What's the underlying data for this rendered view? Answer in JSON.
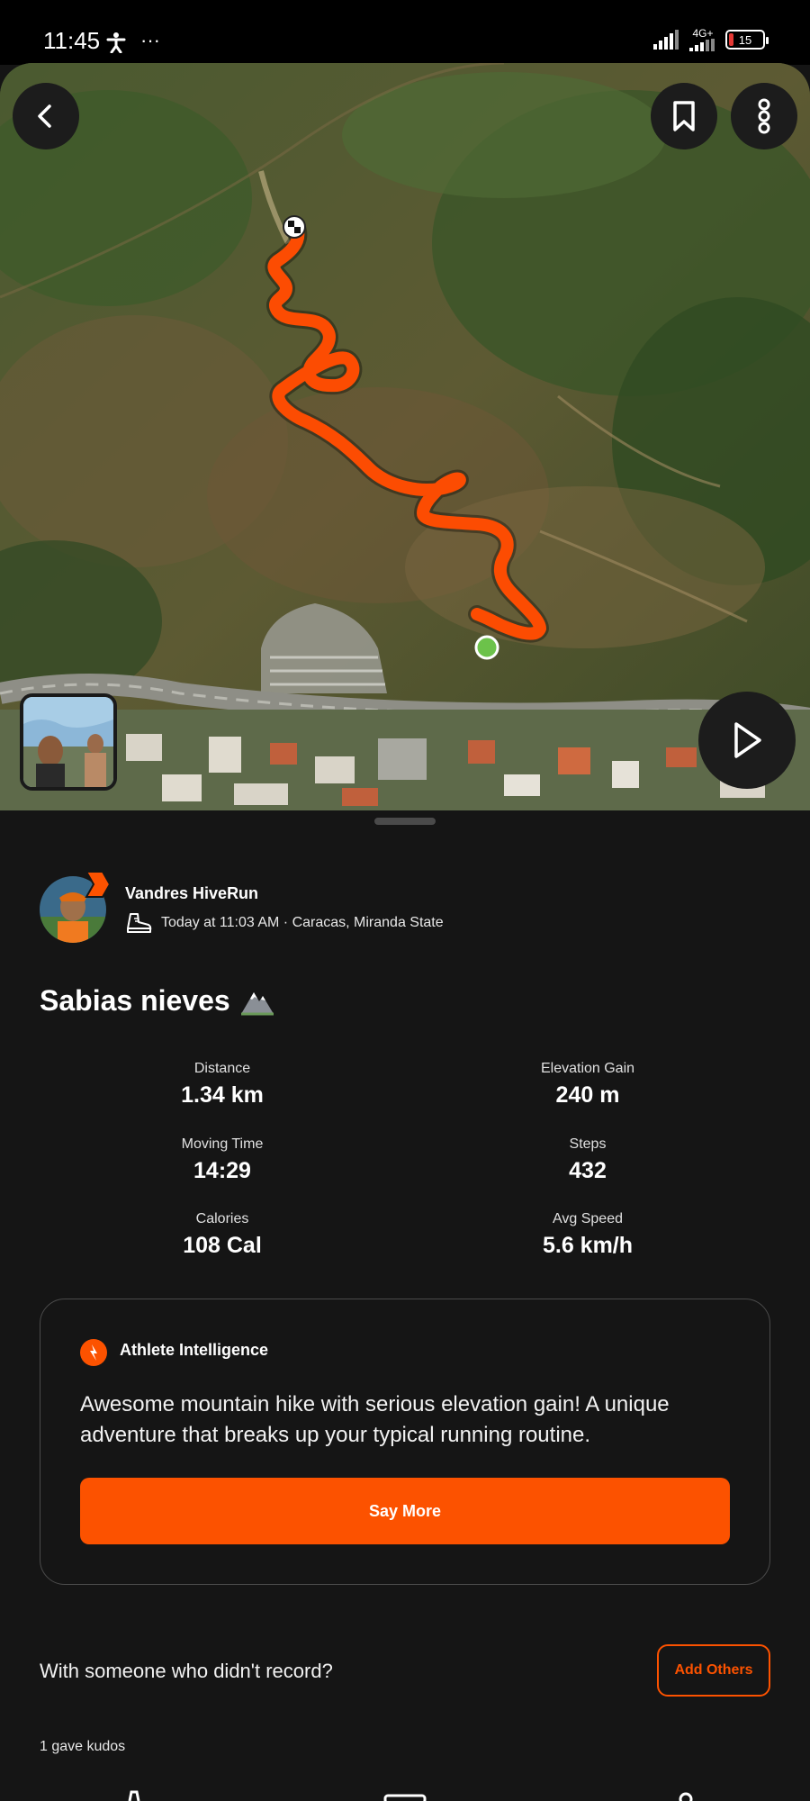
{
  "status_bar": {
    "time": "11:45",
    "left_icons": [
      "accessibility-icon",
      "more-dots-icon"
    ],
    "network": "4G+",
    "battery": "15"
  },
  "map": {
    "top_buttons": [
      "back-icon",
      "bookmark-icon",
      "more-vertical-icon"
    ],
    "play_icon": "play-icon",
    "route_color": "#fc4c02",
    "start_marker_color": "#6cc24a"
  },
  "activity": {
    "athlete_name": "Vandres HiveRun",
    "meta": "Today at 11:03 AM · Caracas, Miranda State",
    "sport_icon": "hiking-boot-icon",
    "title": "Sabias nieves",
    "title_icon": "mountain-icon"
  },
  "stats": [
    {
      "label": "Distance",
      "value": "1.34 km"
    },
    {
      "label": "Elevation Gain",
      "value": "240 m"
    },
    {
      "label": "Moving Time",
      "value": "14:29"
    },
    {
      "label": "Steps",
      "value": "432"
    },
    {
      "label": "Calories",
      "value": "108 Cal"
    },
    {
      "label": "Avg Speed",
      "value": "5.6 km/h"
    }
  ],
  "athlete_intelligence": {
    "title": "Athlete Intelligence",
    "text": "Awesome mountain hike with serious elevation gain! A unique adventure that breaks up your typical running routine.",
    "button": "Say More"
  },
  "add_others": {
    "prompt": "With someone who didn't record?",
    "button": "Add Others"
  },
  "kudos": "1 gave kudos",
  "colors": {
    "accent": "#fc5200",
    "background": "#151515"
  }
}
